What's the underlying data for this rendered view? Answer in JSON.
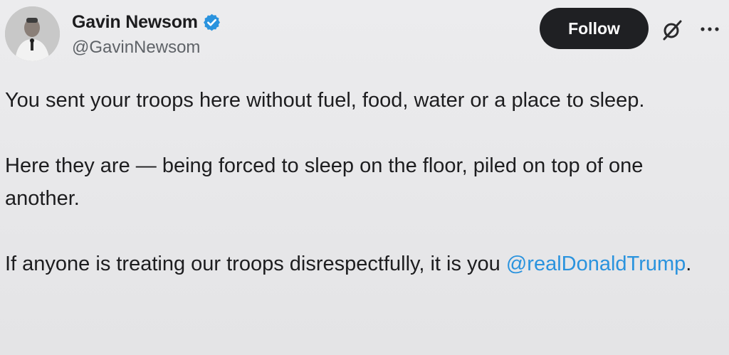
{
  "author": {
    "name": "Gavin Newsom",
    "handle": "@GavinNewsom",
    "verified": true,
    "verified_color": "#2a93de"
  },
  "actions": {
    "follow_label": "Follow",
    "grok_icon": "grok-slash-icon",
    "more_icon": "more-horizontal-icon"
  },
  "tweet": {
    "paragraph1": "You sent your troops here without fuel, food, water or a place to sleep.",
    "paragraph2": "Here they are — being forced to sleep on the floor, piled on top of one another.",
    "paragraph3_text": "If anyone is treating our troops disrespectfully, it is you ",
    "mention": "@realDonaldTrump",
    "paragraph3_end": "."
  },
  "colors": {
    "background": "#e9e9eb",
    "text": "#1d1d1f",
    "secondary": "#5f6368",
    "link": "#2a93de",
    "button": "#1f2023"
  }
}
